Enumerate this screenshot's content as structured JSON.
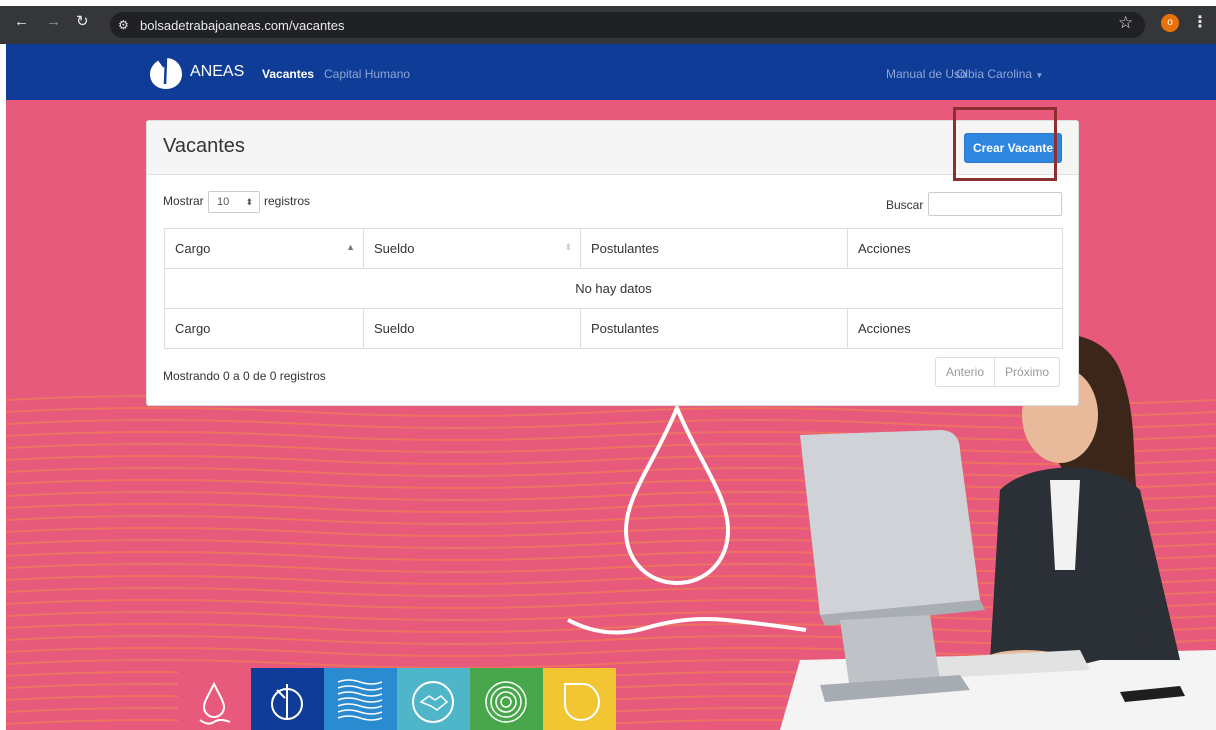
{
  "browser": {
    "url": "bolsadetrabajoaneas.com/vacantes",
    "profile_initial": "o"
  },
  "navbar": {
    "brand": "ANEAS",
    "links": [
      "Vacantes",
      "Capital Humano"
    ],
    "right_links": [
      "Manual de Uso",
      "Olbia Carolina"
    ]
  },
  "panel": {
    "title": "Vacantes",
    "create_button": "Crear Vacante",
    "length_pre": "Mostrar",
    "length_value": "10",
    "length_post": "registros",
    "search_label": "Buscar",
    "columns": [
      "Cargo",
      "Sueldo",
      "Postulantes",
      "Acciones"
    ],
    "empty_message": "No hay datos",
    "info": "Mostrando 0 a 0 de 0 registros",
    "prev": "Anterio",
    "next": "Próximo"
  },
  "colors": {
    "navbar": "#0f3c96",
    "background": "#e85a7c",
    "primary_button": "#2e86de",
    "highlight_box": "#8c2f2f"
  },
  "tiles": [
    {
      "icon": "droplet-wave-icon",
      "color": "#e85a7c"
    },
    {
      "icon": "drop-outline-icon",
      "color": "#0f3c96"
    },
    {
      "icon": "waves-icon",
      "color": "#2a8bd0"
    },
    {
      "icon": "handshake-icon",
      "color": "#4fb5c8"
    },
    {
      "icon": "target-rings-icon",
      "color": "#47a74a"
    },
    {
      "icon": "leaf-shape-icon",
      "color": "#f2c532"
    }
  ]
}
